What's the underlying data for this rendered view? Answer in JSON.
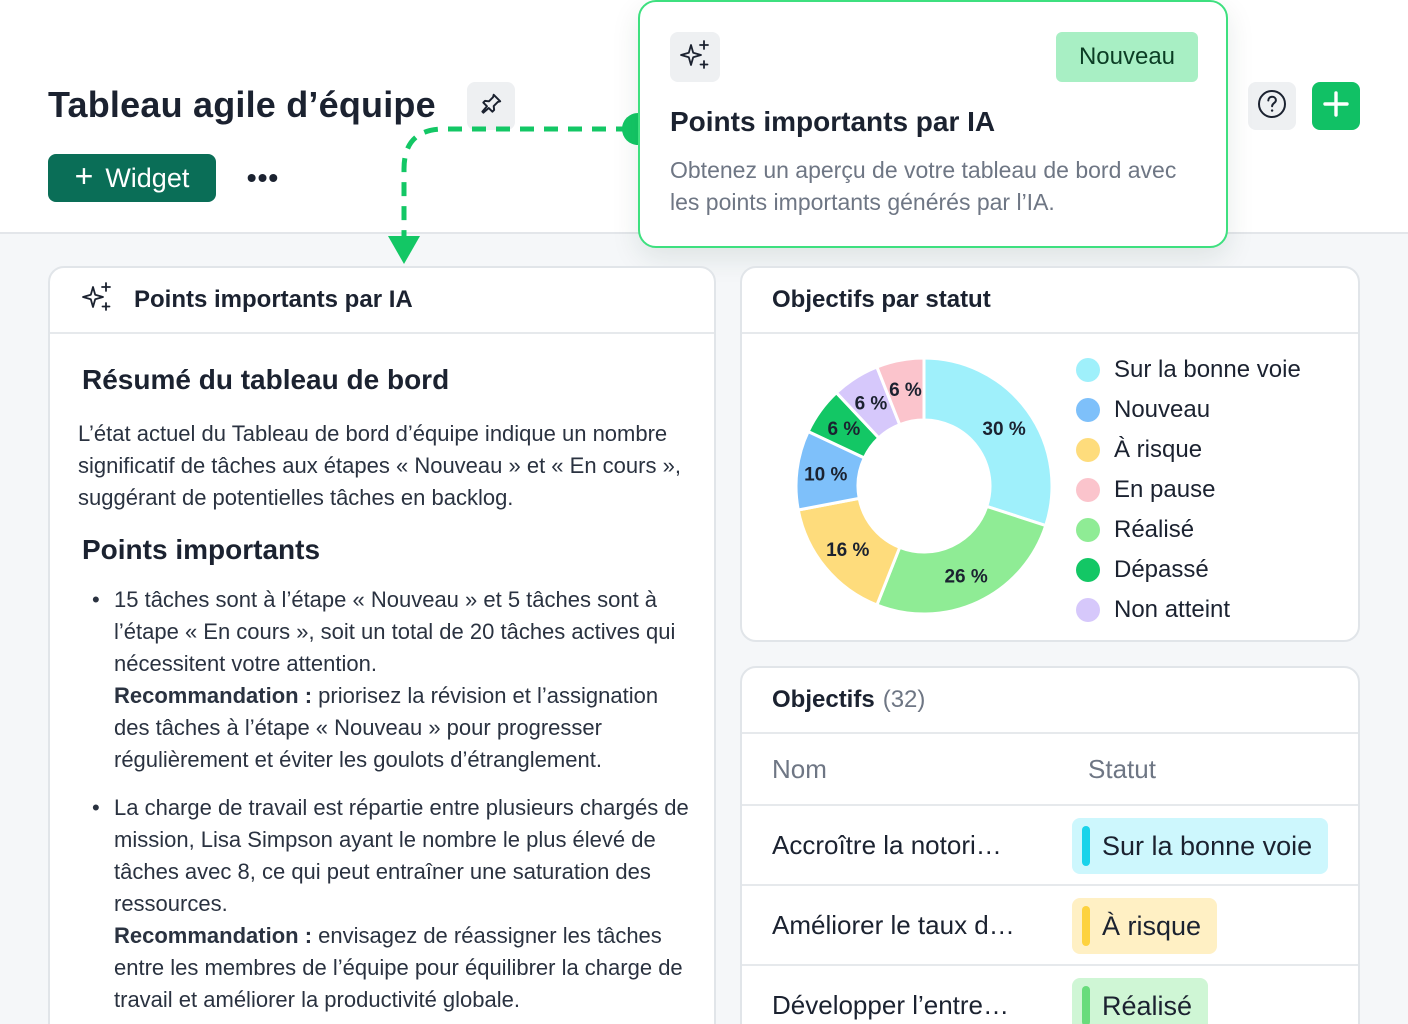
{
  "header": {
    "title": "Tableau agile d’équipe",
    "widget_label": "Widget",
    "more_label": "•••"
  },
  "popup": {
    "badge": "Nouveau",
    "title": "Points importants par IA",
    "description": "Obtenez un aperçu de votre tableau de bord avec les points importants générés par l’IA."
  },
  "ai_card": {
    "title": "Points importants par IA",
    "summary_heading": "Résumé du tableau de bord",
    "summary_text": "L’état actuel du Tableau de bord d’équipe indique un nombre significatif de tâches aux étapes « Nouveau » et « En cours », suggérant de potentielles tâches en backlog.",
    "points_heading": "Points importants",
    "points": [
      {
        "text": "15 tâches sont à l’étape « Nouveau » et 5 tâches sont à l’étape « En cours », soit un total de 20 tâches actives qui nécessitent votre attention.",
        "rec_label": "Recommandation :",
        "rec_text": " priorisez la révision et l’assignation des tâches à l’étape « Nouveau » pour progresser régulièrement et éviter les goulots d’étranglement."
      },
      {
        "text": "La charge de travail est répartie entre plusieurs chargés de mission, Lisa Simpson ayant le nombre le plus élevé de tâches avec 8, ce qui peut entraîner une saturation des ressources.",
        "rec_label": "Recommandation :",
        "rec_text": " envisagez de réassigner les tâches entre les membres de l’équipe pour équilibrer la charge de travail et améliorer la productivité globale."
      }
    ]
  },
  "chart_card": {
    "title": "Objectifs par statut"
  },
  "chart_data": {
    "type": "pie",
    "title": "Objectifs par statut",
    "categories": [
      "Sur la bonne voie",
      "Réalisé",
      "À risque",
      "Nouveau",
      "Dépassé",
      "Non atteint",
      "En pause"
    ],
    "values": [
      30,
      26,
      16,
      10,
      6,
      6,
      6
    ],
    "labels": [
      "30 %",
      "26 %",
      "16 %",
      "10 %",
      "6 %",
      "6 %",
      "6 %"
    ],
    "colors": [
      "#9ff0fb",
      "#8fec95",
      "#fedc7c",
      "#7ec0fa",
      "#13c765",
      "#d6c8fb",
      "#fbc4cc"
    ],
    "legend": [
      {
        "label": "Sur la bonne voie",
        "color": "#9ff0fb"
      },
      {
        "label": "Nouveau",
        "color": "#7ec0fa"
      },
      {
        "label": "À risque",
        "color": "#fedc7c"
      },
      {
        "label": "En pause",
        "color": "#fbc4cc"
      },
      {
        "label": "Réalisé",
        "color": "#8fec95"
      },
      {
        "label": "Dépassé",
        "color": "#13c765"
      },
      {
        "label": "Non atteint",
        "color": "#d6c8fb"
      }
    ],
    "legend_position": "right"
  },
  "objectives": {
    "title": "Objectifs",
    "count": "(32)",
    "col_name": "Nom",
    "col_status": "Statut",
    "rows": [
      {
        "name": "Accroître la notori…",
        "status": "Sur la bonne voie",
        "bg": "#cdf7fd",
        "bar": "#1ad3ea"
      },
      {
        "name": "Améliorer le taux d…",
        "status": "À risque",
        "bg": "#fff0c4",
        "bar": "#fdd23e"
      },
      {
        "name": "Développer l’entre…",
        "status": "Réalisé",
        "bg": "#cff6d5",
        "bar": "#68dc7c"
      }
    ]
  }
}
